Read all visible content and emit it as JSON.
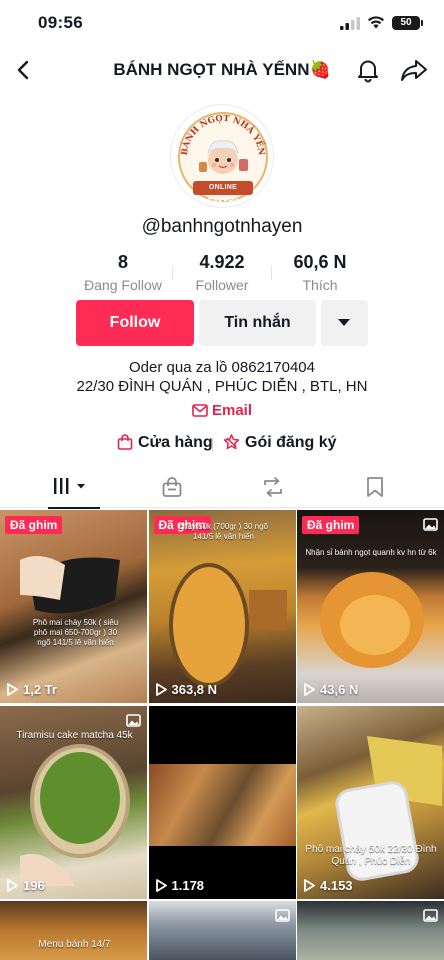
{
  "status": {
    "time": "09:56",
    "battery": "50"
  },
  "header": {
    "title": "BÁNH NGỌT NHÀ YẾNN🍓"
  },
  "profile": {
    "avatar_text_top": "BÁNH NGỌT NHÀ YẾN",
    "avatar_text_bottom": "ONLINE BAKERY",
    "username": "@banhngotnhayen",
    "stats": [
      {
        "value": "8",
        "label": "Đang Follow"
      },
      {
        "value": "4.922",
        "label": "Follower"
      },
      {
        "value": "60,6 N",
        "label": "Thích"
      }
    ],
    "follow_label": "Follow",
    "message_label": "Tin nhắn",
    "bio_line1": "Oder qua za lồ 0862170404",
    "bio_line2": "22/30 ĐÌNH QUÁN , PHÚC DIỄN , BTL, HN",
    "email_label": "Email",
    "shop_label": "Cửa hàng",
    "subscribe_label": "Gói đăng ký"
  },
  "tabs": [
    {
      "name": "videos-grid-icon"
    },
    {
      "name": "shop-bag-icon"
    },
    {
      "name": "repost-icon"
    },
    {
      "name": "bookmark-icon"
    }
  ],
  "videos": [
    {
      "pinned": "Đã ghim",
      "views": "1,2 Tr",
      "overlay": "Phô mai chảy 50k ( siêu phô mai 650-700gr ) 30 ngõ 141/5 lê văn hiến",
      "photo": false
    },
    {
      "pinned": "Đã ghim",
      "views": "363,8 N",
      "overlay": "chảy 50k (700gr ) 30 ngõ 141/5 lê văn hiến",
      "photo": false
    },
    {
      "pinned": "Đã ghim",
      "views": "43,6 N",
      "overlay": "Nhận sỉ bánh ngọt quanh kv hn từ 6k",
      "photo": true
    },
    {
      "pinned": "",
      "views": "196",
      "overlay": "Tiramisu cake matcha 45k",
      "photo": true
    },
    {
      "pinned": "",
      "views": "1.178",
      "overlay": "",
      "photo": false
    },
    {
      "pinned": "",
      "views": "4.153",
      "overlay": "Phô mai chảy 50k 22/30 Đình Quán , Phúc Diễn",
      "photo": false
    },
    {
      "pinned": "",
      "views": "",
      "overlay": "Menu bánh 14/7",
      "photo": false
    },
    {
      "pinned": "",
      "views": "",
      "overlay": "",
      "photo": true
    },
    {
      "pinned": "",
      "views": "",
      "overlay": "",
      "photo": true
    }
  ],
  "colors": {
    "accent": "#fe2c55",
    "email": "#e3224f",
    "text": "#161823",
    "muted": "#8a8b91"
  }
}
